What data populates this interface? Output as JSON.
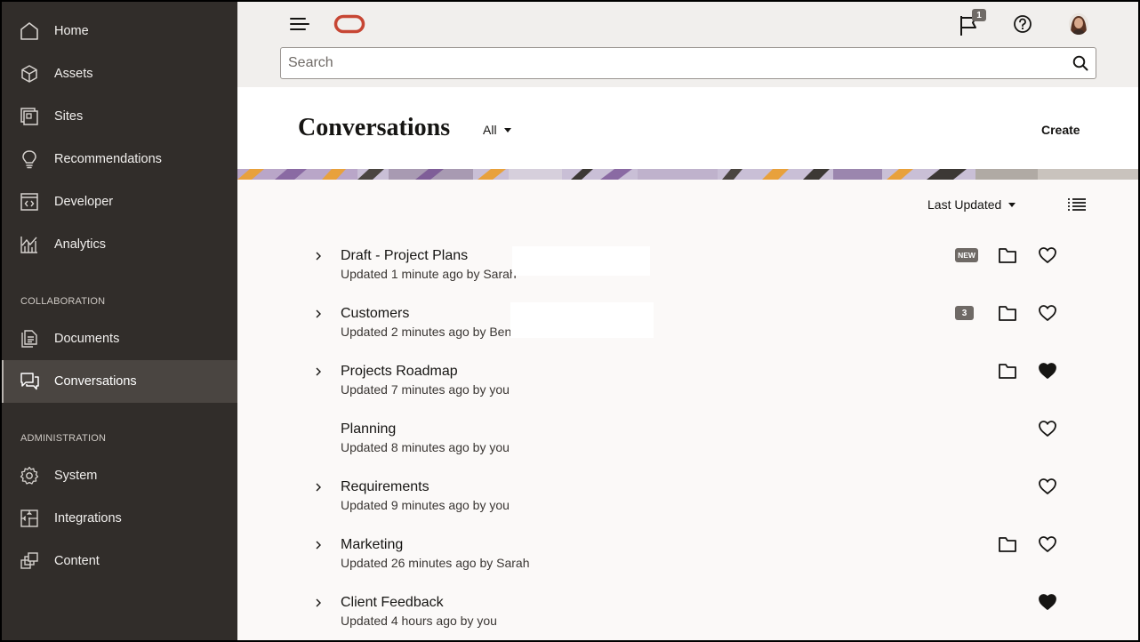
{
  "sidebar": {
    "items": [
      {
        "label": "Home",
        "icon": "home-icon"
      },
      {
        "label": "Assets",
        "icon": "cube-icon"
      },
      {
        "label": "Sites",
        "icon": "sites-icon"
      },
      {
        "label": "Recommendations",
        "icon": "lightbulb-icon"
      },
      {
        "label": "Developer",
        "icon": "code-window-icon"
      },
      {
        "label": "Analytics",
        "icon": "analytics-chart-icon"
      }
    ],
    "collaboration_header": "COLLABORATION",
    "collaboration_items": [
      {
        "label": "Documents",
        "icon": "documents-icon"
      },
      {
        "label": "Conversations",
        "icon": "conversations-icon",
        "active": true
      }
    ],
    "administration_header": "ADMINISTRATION",
    "administration_items": [
      {
        "label": "System",
        "icon": "gear-icon"
      },
      {
        "label": "Integrations",
        "icon": "puzzle-icon"
      },
      {
        "label": "Content",
        "icon": "content-stack-icon"
      }
    ]
  },
  "header": {
    "search_placeholder": "Search",
    "notification_count": "1",
    "colors": {
      "logo": "#c74634",
      "header_bg": "#f1efed"
    }
  },
  "page": {
    "title": "Conversations",
    "filter_label": "All",
    "create_label": "Create",
    "sort_label": "Last Updated"
  },
  "conversations": [
    {
      "title": "Draft - Project Plans",
      "subtitle": "Updated 1 minute ago by Sarah",
      "expandable": true,
      "badge": "NEW",
      "folder": true,
      "favorite": false
    },
    {
      "title": "Customers",
      "subtitle": "Updated 2 minutes ago by Ben",
      "expandable": true,
      "badge": "3",
      "folder": true,
      "favorite": false
    },
    {
      "title": "Projects Roadmap",
      "subtitle": "Updated 7 minutes ago by you",
      "expandable": true,
      "badge": "",
      "folder": true,
      "favorite": true
    },
    {
      "title": "Planning",
      "subtitle": "Updated 8 minutes ago by you",
      "expandable": false,
      "badge": "",
      "folder": false,
      "favorite": false
    },
    {
      "title": "Requirements",
      "subtitle": "Updated 9 minutes ago by you",
      "expandable": true,
      "badge": "",
      "folder": false,
      "favorite": false
    },
    {
      "title": "Marketing",
      "subtitle": "Updated 26 minutes ago by Sarah",
      "expandable": true,
      "badge": "",
      "folder": true,
      "favorite": false
    },
    {
      "title": "Client Feedback",
      "subtitle": "Updated 4 hours ago by you",
      "expandable": true,
      "badge": "",
      "folder": false,
      "favorite": true
    }
  ]
}
